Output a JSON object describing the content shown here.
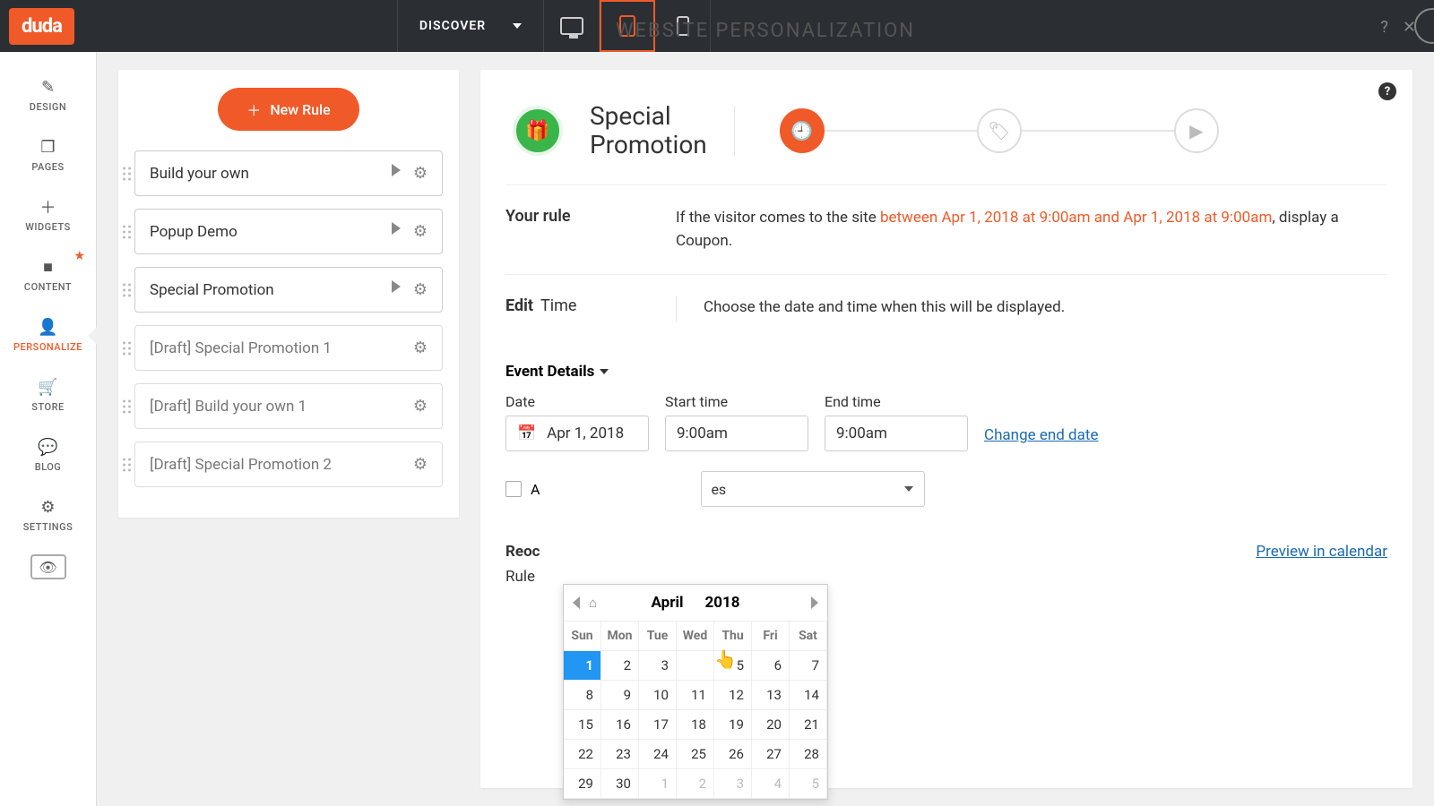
{
  "topbar": {
    "logo": "duda",
    "discover": "DISCOVER"
  },
  "leftnav": {
    "items": [
      {
        "label": "DESIGN"
      },
      {
        "label": "PAGES"
      },
      {
        "label": "WIDGETS"
      },
      {
        "label": "CONTENT"
      },
      {
        "label": "PERSONALIZE"
      },
      {
        "label": "STORE"
      },
      {
        "label": "BLOG"
      },
      {
        "label": "SETTINGS"
      }
    ]
  },
  "panel_title": "WEBSITE PERSONALIZATION",
  "rules": {
    "new_rule": "New Rule",
    "items": [
      {
        "label": "Build your own",
        "draft": false,
        "play": true
      },
      {
        "label": "Popup Demo",
        "draft": false,
        "play": true
      },
      {
        "label": "Special Promotion",
        "draft": false,
        "play": true
      },
      {
        "label": "[Draft] Special Promotion 1",
        "draft": true,
        "play": false
      },
      {
        "label": "[Draft] Build your own 1",
        "draft": true,
        "play": false
      },
      {
        "label": "[Draft] Special Promotion 2",
        "draft": true,
        "play": false
      }
    ]
  },
  "editor": {
    "title_line1": "Special",
    "title_line2": "Promotion",
    "your_rule_label": "Your rule",
    "rule_text_prefix": "If the visitor comes to the site ",
    "rule_text_highlight": "between Apr 1, 2018 at 9:00am and Apr 1, 2018 at 9:00am",
    "rule_text_suffix": ", display a Coupon.",
    "edit_bold": "Edit",
    "edit_light": "Time",
    "edit_desc": "Choose the date and time when this will be displayed.",
    "event_details": "Event Details",
    "date_label": "Date",
    "date_value": "Apr 1, 2018",
    "start_label": "Start time",
    "start_value": "9:00am",
    "end_label": "End time",
    "end_value": "9:00am",
    "change_end": "Change end date",
    "checkbox_label": "A",
    "select_suffix": "es",
    "reoc_label": "Reoc",
    "rule_label2": "Rule",
    "preview_link": "Preview in calendar"
  },
  "calendar": {
    "month": "April",
    "year": "2018",
    "dow": [
      "Sun",
      "Mon",
      "Tue",
      "Wed",
      "Thu",
      "Fri",
      "Sat"
    ],
    "weeks": [
      [
        {
          "d": "1",
          "sel": true
        },
        {
          "d": "2"
        },
        {
          "d": "3"
        },
        {
          "d": ""
        },
        {
          "d": "5"
        },
        {
          "d": "6"
        },
        {
          "d": "7"
        }
      ],
      [
        {
          "d": "8"
        },
        {
          "d": "9"
        },
        {
          "d": "10"
        },
        {
          "d": "11"
        },
        {
          "d": "12"
        },
        {
          "d": "13"
        },
        {
          "d": "14"
        }
      ],
      [
        {
          "d": "15"
        },
        {
          "d": "16"
        },
        {
          "d": "17"
        },
        {
          "d": "18"
        },
        {
          "d": "19"
        },
        {
          "d": "20"
        },
        {
          "d": "21"
        }
      ],
      [
        {
          "d": "22"
        },
        {
          "d": "23"
        },
        {
          "d": "24"
        },
        {
          "d": "25"
        },
        {
          "d": "26"
        },
        {
          "d": "27"
        },
        {
          "d": "28"
        }
      ],
      [
        {
          "d": "29"
        },
        {
          "d": "30"
        },
        {
          "d": "1",
          "other": true
        },
        {
          "d": "2",
          "other": true
        },
        {
          "d": "3",
          "other": true
        },
        {
          "d": "4",
          "other": true
        },
        {
          "d": "5",
          "other": true
        }
      ]
    ]
  }
}
